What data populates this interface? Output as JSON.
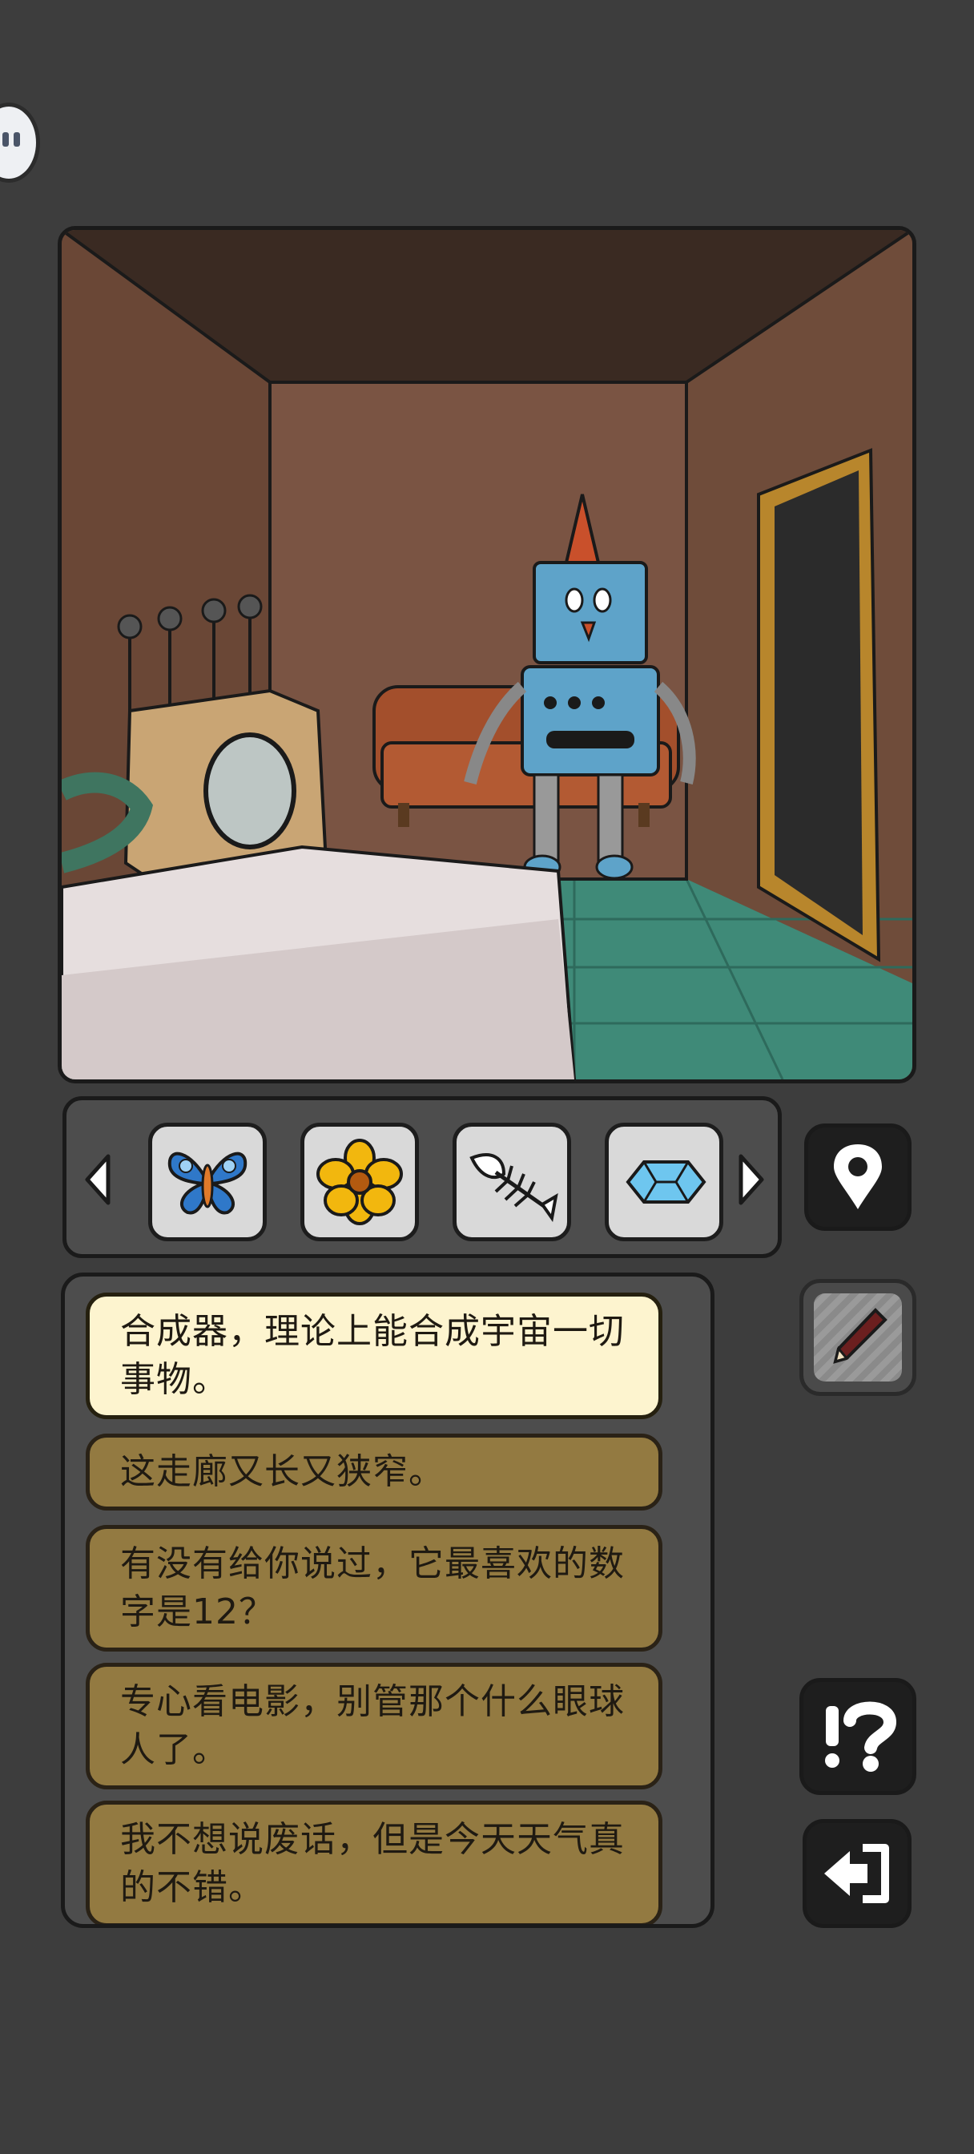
{
  "inventory": {
    "items": [
      {
        "name": "butterfly-icon"
      },
      {
        "name": "flower-icon"
      },
      {
        "name": "fishbone-icon"
      },
      {
        "name": "crystal-icon"
      }
    ]
  },
  "dialogue": {
    "options": [
      {
        "text": "合成器，理论上能合成宇宙一切事物。",
        "selected": true
      },
      {
        "text": "这走廊又长又狭窄。",
        "selected": false
      },
      {
        "text": "有没有给你说过，它最喜欢的数字是12？",
        "selected": false
      },
      {
        "text": "专心看电影，别管那个什么眼球人了。",
        "selected": false
      },
      {
        "text": "我不想说废话，但是今天天气真的不错。",
        "selected": false
      }
    ]
  },
  "colors": {
    "background": "#3d3d3d",
    "panel": "#4d4d4d",
    "option_active": "#fdf4cf",
    "option_normal": "#937a41"
  }
}
